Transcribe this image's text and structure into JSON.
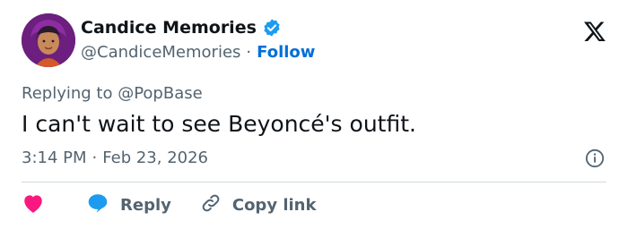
{
  "author": {
    "display_name": "Candice Memories",
    "handle": "@CandiceMemories",
    "separator": "·",
    "follow_label": "Follow",
    "verified": true,
    "avatar": "woman-purple-headscarf-avatar"
  },
  "tweet": {
    "replying_to": "Replying to @PopBase",
    "text": "I can't wait to see Beyoncé's outfit.",
    "time": "3:14 PM",
    "separator": "·",
    "date": "Feb 23, 2026"
  },
  "actions": {
    "reply_label": "Reply",
    "copy_label": "Copy link"
  },
  "icons": {
    "brand": "x-logo-icon",
    "info": "info-icon",
    "like": "heart-icon",
    "reply": "speech-bubble-icon",
    "copy": "link-icon"
  },
  "colors": {
    "text": "#0f1419",
    "muted": "#536471",
    "link": "#006fd6",
    "verified": "#1d9bf0",
    "heart": "#f91880",
    "reply_bubble": "#1d9bf0",
    "divider": "#cfd9de"
  }
}
